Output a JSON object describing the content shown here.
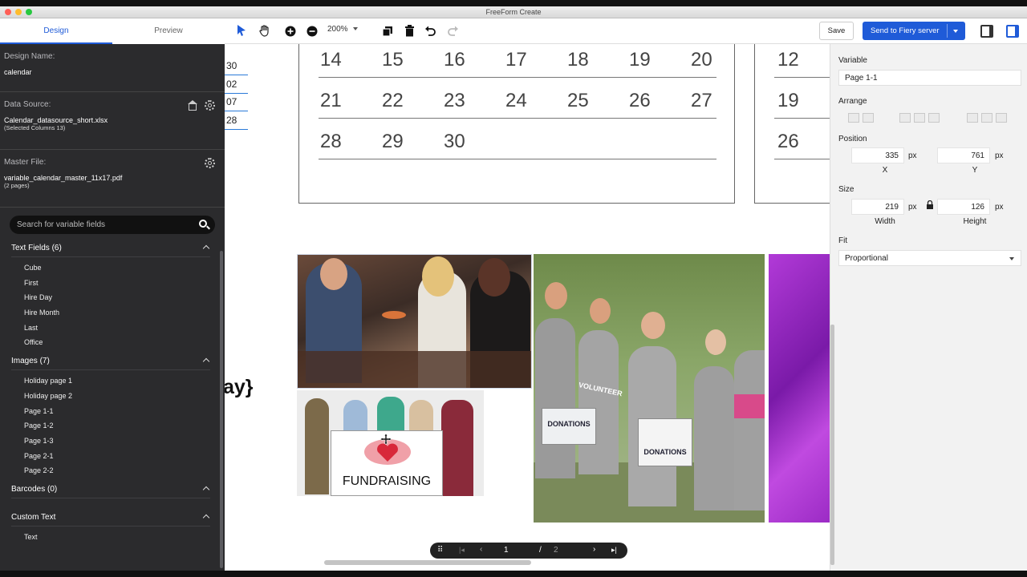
{
  "window": {
    "title": "FreeForm Create"
  },
  "sidebar": {
    "tabs": [
      {
        "label": "Design"
      },
      {
        "label": "Preview"
      }
    ],
    "design_name": {
      "label": "Design Name:",
      "value": "calendar"
    },
    "data_source": {
      "label": "Data Source:",
      "value": "Calendar_datasource_short.xlsx",
      "sub": "(Selected Columns 13)"
    },
    "master_file": {
      "label": "Master File:",
      "value": "variable_calendar_master_11x17.pdf",
      "sub": "(2 pages)"
    },
    "search": {
      "placeholder": "Search for variable fields"
    },
    "groups": [
      {
        "title": "Text Fields (6)",
        "items": [
          "Cube",
          "First",
          "Hire Day",
          "Hire Month",
          "Last",
          "Office"
        ]
      },
      {
        "title": "Images (7)",
        "items": [
          "Holiday page 1",
          "Holiday page 2",
          "Page 1-1",
          "Page 1-2",
          "Page 1-3",
          "Page 2-1",
          "Page 2-2"
        ]
      },
      {
        "title": "Barcodes (0)",
        "items": []
      },
      {
        "title": "Custom Text",
        "items": [
          "Text"
        ]
      }
    ]
  },
  "toolbar": {
    "zoom": "200%",
    "save_label": "Save",
    "send_label": "Send to Fiery server"
  },
  "canvas": {
    "left_numbers": [
      "30",
      "02",
      "07",
      "28"
    ],
    "calendar_rows": [
      [
        "14",
        "15",
        "16",
        "17",
        "18",
        "19",
        "20"
      ],
      [
        "21",
        "22",
        "23",
        "24",
        "25",
        "26",
        "27"
      ],
      [
        "28",
        "29",
        "30"
      ]
    ],
    "right_numbers": [
      "12",
      "19",
      "26"
    ],
    "partial_text": "ay}",
    "photo_labels": {
      "fundraising": "FUNDRAISING",
      "donations_1": "DONATIONS",
      "donations_2": "DONATIONS",
      "volunteer": "VOLUNTEER"
    },
    "pager": {
      "current": "1",
      "separator": "/",
      "total": "2"
    }
  },
  "properties": {
    "variable_label": "Variable",
    "variable_value": "Page 1-1",
    "arrange_label": "Arrange",
    "position_label": "Position",
    "x_value": "335",
    "y_value": "761",
    "x_caption": "X",
    "y_caption": "Y",
    "unit": "px",
    "size_label": "Size",
    "width_value": "219",
    "height_value": "126",
    "width_caption": "Width",
    "height_caption": "Height",
    "fit_label": "Fit",
    "fit_value": "Proportional"
  },
  "colors": {
    "accent": "#1f5bd8",
    "sidebar_bg": "#2b2b2d"
  }
}
